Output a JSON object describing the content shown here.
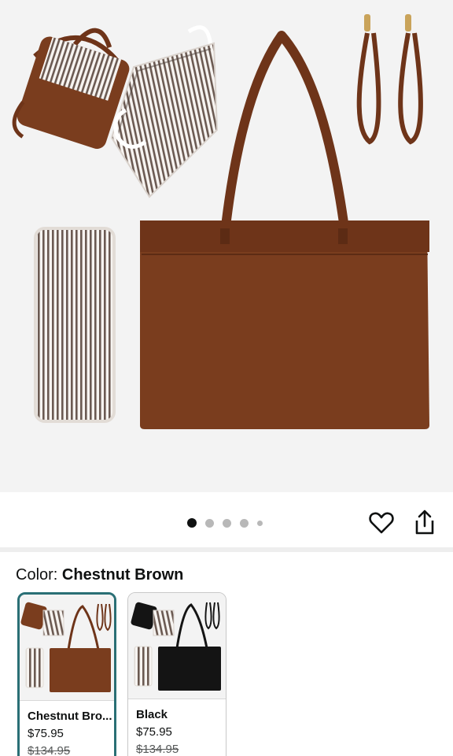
{
  "product": {
    "image_alt": "Chestnut Brown leather tote bag with striped organizer insert, changing pad and wristlet straps",
    "carousel": {
      "total_images": 5,
      "active_index": 0
    }
  },
  "actions": {
    "favorite_icon": "heart-outline-icon",
    "share_icon": "share-icon"
  },
  "color_selector": {
    "label": "Color: ",
    "selected": "Chestnut Brown",
    "options": [
      {
        "name": "Chestnut Bro...",
        "price": "$75.95",
        "list_price": "$134.95",
        "bag_color": "#7a3d1e"
      },
      {
        "name": "Black",
        "price": "$75.95",
        "list_price": "$134.95",
        "bag_color": "#141414"
      }
    ]
  },
  "colors": {
    "leather_brown": "#7a3d1e",
    "accent_teal": "#2a6f75",
    "stripe": "#6b5a52"
  }
}
